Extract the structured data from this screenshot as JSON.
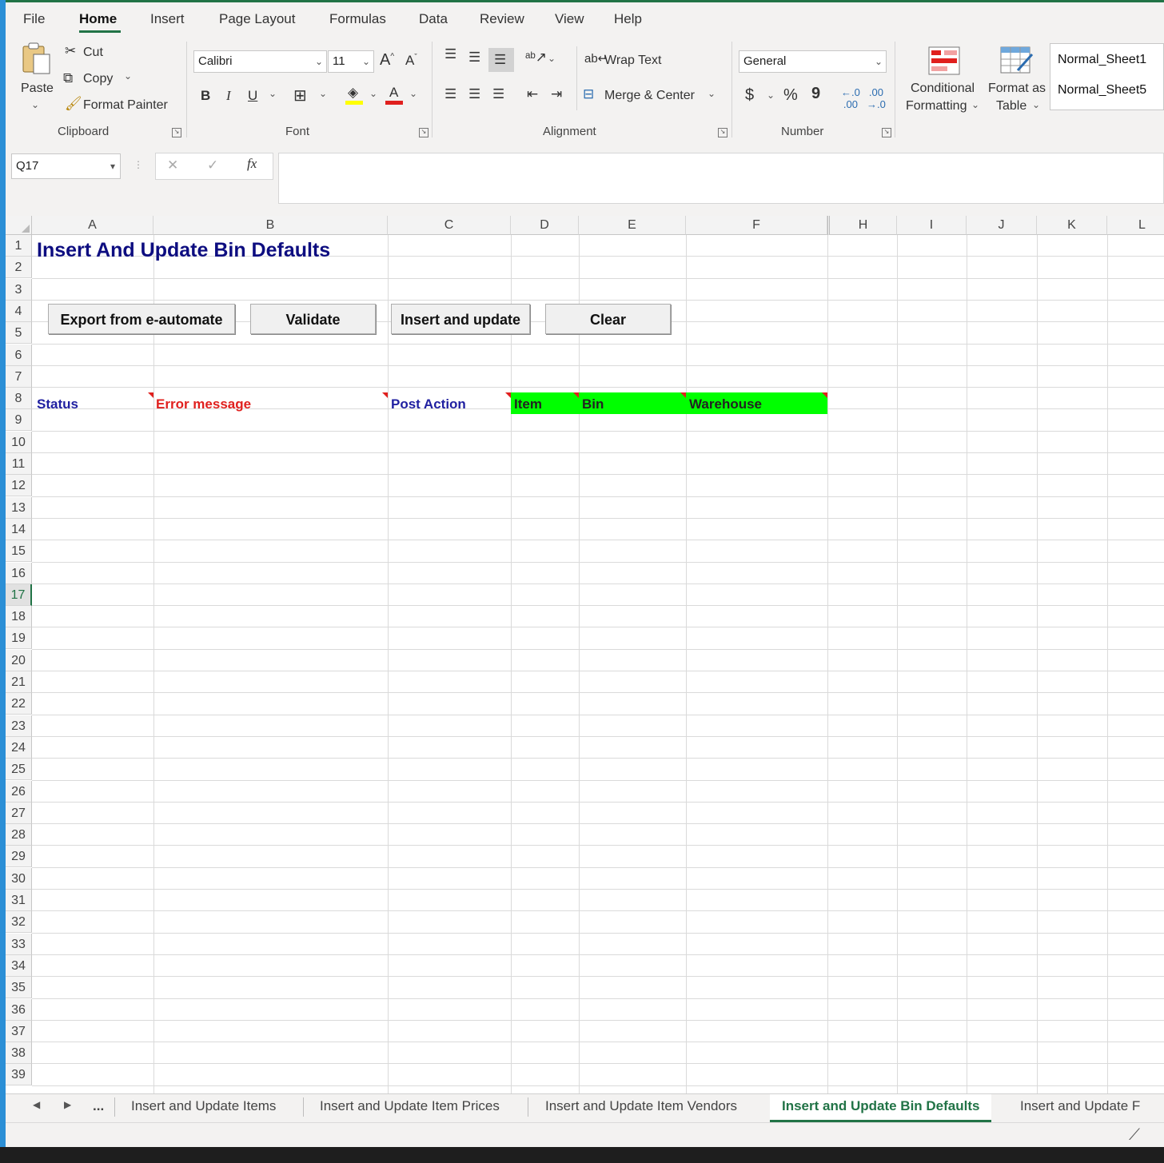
{
  "menu": {
    "tabs": [
      "File",
      "Home",
      "Insert",
      "Page Layout",
      "Formulas",
      "Data",
      "Review",
      "View",
      "Help"
    ],
    "active_tab": "Home"
  },
  "ribbon": {
    "clipboard": {
      "paste": "Paste",
      "cut": "Cut",
      "copy": "Copy",
      "format_painter": "Format Painter",
      "label": "Clipboard"
    },
    "font": {
      "family": "Calibri",
      "size": "11",
      "bold": "B",
      "italic": "I",
      "underline": "U",
      "label": "Font",
      "fill_color": "#ffff00",
      "font_color": "#e0201e"
    },
    "alignment": {
      "wrap_text": "Wrap Text",
      "merge_center": "Merge & Center",
      "label": "Alignment"
    },
    "number": {
      "format": "General",
      "currency": "$",
      "percent": "%",
      "comma": "9",
      "label": "Number"
    },
    "styles": {
      "conditional_1": "Conditional",
      "conditional_2": "Formatting",
      "format_table_1": "Format as",
      "format_table_2": "Table",
      "style_1": "Normal_Sheet1",
      "style_2": "Normal_Sheet5"
    }
  },
  "formula_bar": {
    "name_box": "Q17",
    "fx": "fx",
    "content": ""
  },
  "grid": {
    "columns": [
      "A",
      "B",
      "C",
      "D",
      "E",
      "F",
      "H",
      "I",
      "J",
      "K",
      "L"
    ],
    "rows": [
      "1",
      "2",
      "3",
      "4",
      "5",
      "6",
      "7",
      "8",
      "9",
      "10",
      "11",
      "12",
      "13",
      "14",
      "15",
      "16",
      "17",
      "18",
      "19",
      "20",
      "21",
      "22",
      "23",
      "24",
      "25",
      "26",
      "27",
      "28",
      "29",
      "30",
      "31",
      "32",
      "33",
      "34",
      "35",
      "36",
      "37",
      "38",
      "39"
    ],
    "selected_row": "17",
    "title": "Insert And Update Bin Defaults",
    "title_color": "#0d0d80",
    "buttons": [
      "Export from e-automate",
      "Validate",
      "Insert and update",
      "Clear"
    ],
    "headers": {
      "status": "Status",
      "error": "Error message",
      "post_action": "Post Action",
      "item": "Item",
      "bin": "Bin",
      "warehouse": "Warehouse"
    },
    "header_colors": {
      "status": "#1f1fa0",
      "error": "#e0201e",
      "post_action": "#1f1fa0",
      "green_fill": "#00ff00"
    }
  },
  "sheets": {
    "nav_ellipsis": "...",
    "tabs": [
      "Insert and Update Items",
      "Insert and Update Item Prices",
      "Insert and Update Item Vendors",
      "Insert and Update Bin Defaults",
      "Insert and Update F"
    ],
    "active": "Insert and Update Bin Defaults"
  }
}
